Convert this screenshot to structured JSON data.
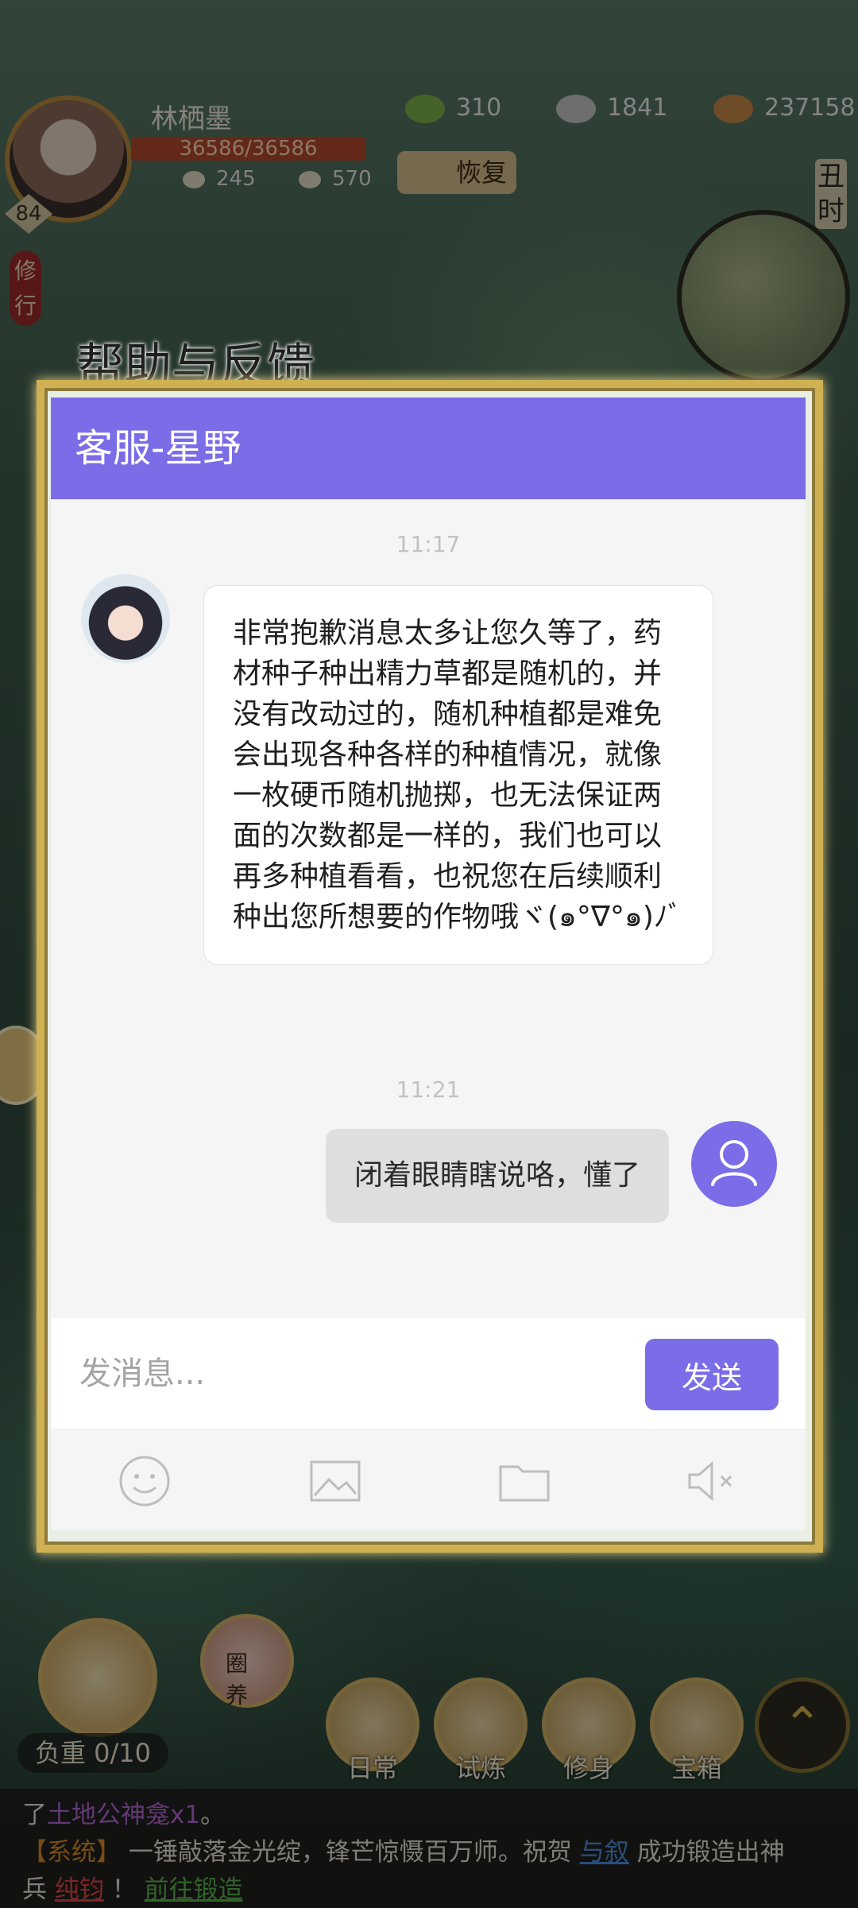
{
  "hud": {
    "player_name": "林栖墨",
    "hp": "36586/36586",
    "stat_a": "245",
    "stat_b": "570",
    "level": "84",
    "res1": "310",
    "res2": "1841",
    "res3": "237158",
    "recover_label": "恢复",
    "time_label": "丑时",
    "practice_label": "修行"
  },
  "dialog": {
    "title": "帮助与反馈",
    "header": "客服-星野",
    "messages": [
      {
        "time": "11:17",
        "from": "agent",
        "text": "非常抱歉消息太多让您久等了，药材种子种出精力草都是随机的，并没有改动过的，随机种植都是难免会出现各种各样的种植情况，就像一枚硬币随机抛掷，也无法保证两面的次数都是一样的，我们也可以再多种植看看，也祝您在后续顺利种出您所想要的作物哦ヾ(๑°∇°๑)ﾉﾞ"
      },
      {
        "time": "11:21",
        "from": "user",
        "text": "闭着眼睛瞎说咯，懂了"
      }
    ],
    "input_placeholder": "发消息...",
    "send_label": "发送",
    "tools": [
      "smile-icon",
      "image-icon",
      "folder-icon",
      "mute-icon"
    ]
  },
  "bottom": {
    "weight": "负重 0/10",
    "pig_label": "圈养",
    "buttons": [
      "日常",
      "试炼",
      "修身",
      "宝箱"
    ]
  },
  "system_chat": {
    "line1_prefix": "了",
    "line1_item": "土地公神龛x1",
    "line1_suffix": "。",
    "tag": "【系统】",
    "body": "一锤敲落金光绽，锋芒惊慑百万师。祝贺",
    "player": "与叙",
    "body2": "成功锻造出神",
    "line3_prefix": "兵",
    "weapon": "纯钧",
    "excl": "！",
    "action": "前往锻造"
  },
  "colors": {
    "accent": "#7b6ce8",
    "frame_gold": "#cfb154"
  }
}
